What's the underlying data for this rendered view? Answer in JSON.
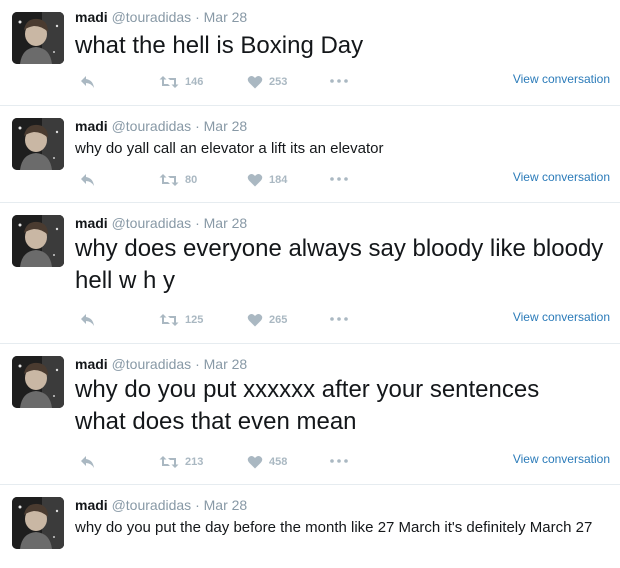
{
  "tweets": [
    {
      "name": "madi",
      "handle": "@touradidas",
      "separator": "·",
      "date": "Mar 28",
      "text": "what the hell is Boxing Day",
      "retweets": "146",
      "likes": "253",
      "view_conversation": "View conversation"
    },
    {
      "name": "madi",
      "handle": "@touradidas",
      "separator": "·",
      "date": "Mar 28",
      "text": "why do yall call an elevator a lift its an elevator",
      "retweets": "80",
      "likes": "184",
      "view_conversation": "View conversation"
    },
    {
      "name": "madi",
      "handle": "@touradidas",
      "separator": "·",
      "date": "Mar 28",
      "text": "why does everyone always say bloody like bloody hell w h y",
      "retweets": "125",
      "likes": "265",
      "view_conversation": "View conversation"
    },
    {
      "name": "madi",
      "handle": "@touradidas",
      "separator": "·",
      "date": "Mar 28",
      "text": "why do you put xxxxxx after your sentences what does that even mean",
      "retweets": "213",
      "likes": "458",
      "view_conversation": "View conversation"
    },
    {
      "name": "madi",
      "handle": "@touradidas",
      "separator": "·",
      "date": "Mar 28",
      "text": "why do you put the day before the month like 27 March it's definitely March 27"
    }
  ],
  "icons": {
    "reply": "reply-icon",
    "retweet": "retweet-icon",
    "like": "heart-icon",
    "more": "more-dots-icon",
    "avatar": "avatar"
  },
  "colors": {
    "text": "#14171a",
    "meta": "#8899a6",
    "action": "#aab8c2",
    "link": "#2b7bb9",
    "divider": "#e6ecf0"
  }
}
